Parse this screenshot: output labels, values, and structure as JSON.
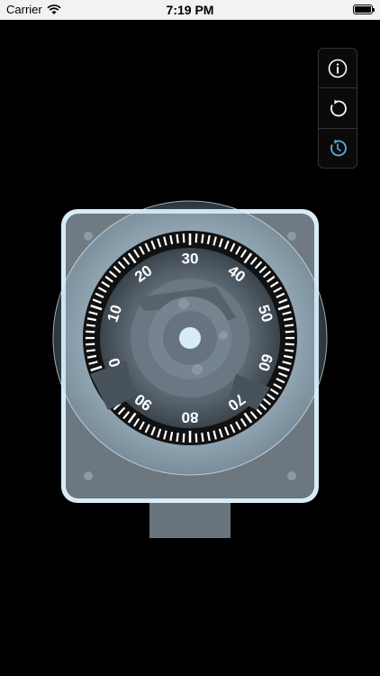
{
  "status_bar": {
    "carrier": "Carrier",
    "time": "7:19 PM"
  },
  "toolbar": {
    "buttons": [
      {
        "icon": "info-icon"
      },
      {
        "icon": "reset-icon"
      },
      {
        "icon": "history-icon",
        "active": true
      }
    ],
    "active_color": "#5aaee6"
  },
  "dial": {
    "numbers": [
      "0",
      "10",
      "20",
      "30",
      "40",
      "50",
      "60",
      "70",
      "80",
      "90"
    ],
    "body_color": "#5f6b75",
    "frame_color": "#8a949c",
    "glow_color": "#cfe9f7"
  }
}
